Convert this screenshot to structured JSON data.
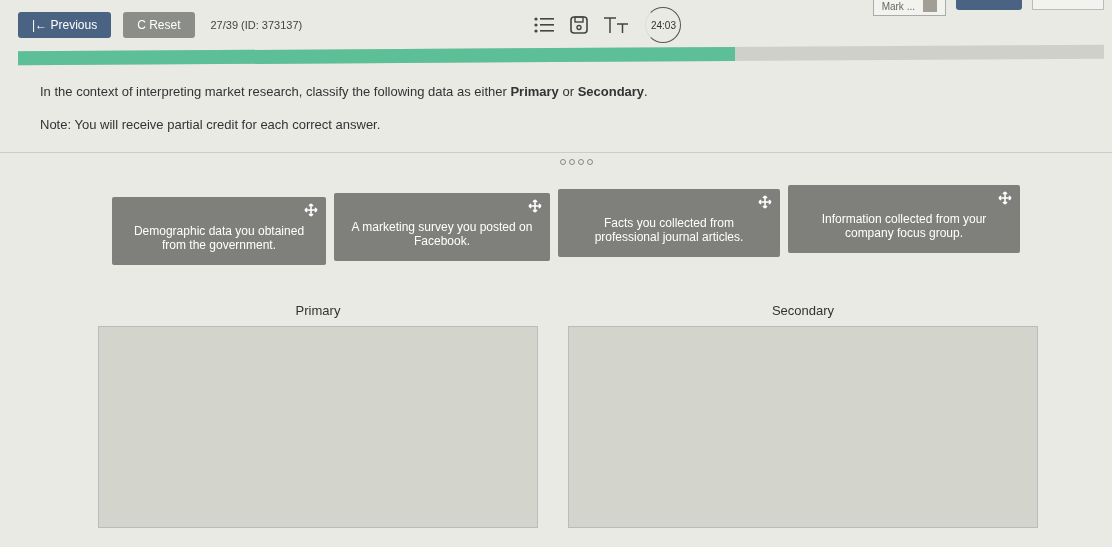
{
  "toolbar": {
    "previous": "|← Previous",
    "reset": "C Reset",
    "position": "27/39 (ID: 373137)",
    "timer": "24:03",
    "mark": "Mark ...",
    "mark_checked": false
  },
  "progress": {
    "level": 0.66
  },
  "question": {
    "prompt": "In the context of interpreting market research, classify the following data as either **Primary** or **Secondary**.",
    "note": "Note: You will receive partial credit for each correct answer."
  },
  "cards": [
    {
      "text": "Demographic data you obtained from the government."
    },
    {
      "text": "A marketing survey you posted on Facebook."
    },
    {
      "text": "Facts you collected from professional journal articles."
    },
    {
      "text": "Information collected from your company focus group."
    }
  ],
  "zones": [
    {
      "label": "Primary"
    },
    {
      "label": "Secondary"
    }
  ]
}
